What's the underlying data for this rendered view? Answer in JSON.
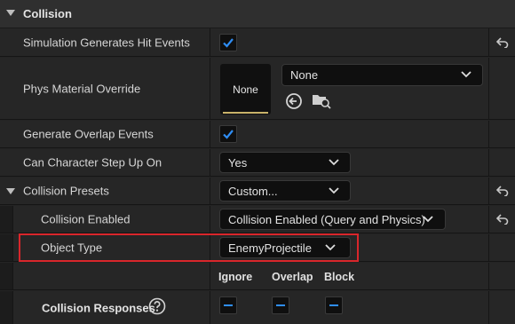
{
  "section": {
    "title": "Collision"
  },
  "rows": {
    "sim_hit": {
      "label": "Simulation Generates Hit Events",
      "checked": true
    },
    "phys_mat": {
      "label": "Phys Material Override",
      "thumb_text": "None",
      "dropdown_value": "None"
    },
    "overlap": {
      "label": "Generate Overlap Events",
      "checked": true
    },
    "step_up": {
      "label": "Can Character Step Up On",
      "dropdown_value": "Yes"
    },
    "presets": {
      "label": "Collision Presets",
      "dropdown_value": "Custom..."
    },
    "enabled": {
      "label": "Collision Enabled",
      "dropdown_value": "Collision Enabled (Query and Physics)"
    },
    "object_type": {
      "label": "Object Type",
      "dropdown_value": "EnemyProjectile"
    },
    "responses": {
      "label": "Collision Responses",
      "headers": [
        "Ignore",
        "Overlap",
        "Block"
      ]
    }
  },
  "icons": {
    "reset": "reset-arrow-icon",
    "help": "question-circle-icon",
    "browse_back": "arrow-left-circle-icon",
    "browse_folder": "folder-search-icon"
  },
  "colors": {
    "accent": "#2f8ef5",
    "highlight": "#d9262b"
  }
}
